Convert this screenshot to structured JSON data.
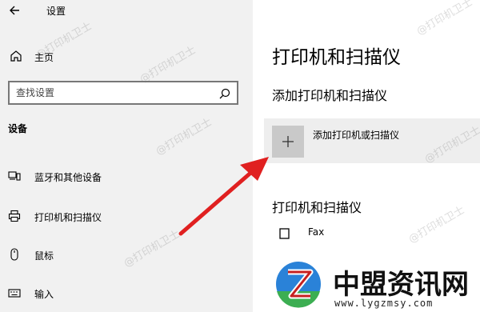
{
  "window": {
    "title": "设置"
  },
  "sidebar": {
    "home_label": "主页",
    "search": {
      "placeholder": "查找设置"
    },
    "section_heading": "设备",
    "items": [
      {
        "label": "蓝牙和其他设备",
        "icon": "devices-icon"
      },
      {
        "label": "打印机和扫描仪",
        "icon": "printer-icon"
      },
      {
        "label": "鼠标",
        "icon": "mouse-icon"
      },
      {
        "label": "输入",
        "icon": "keyboard-icon"
      }
    ]
  },
  "main": {
    "title": "打印机和扫描仪",
    "add_section_title": "添加打印机和扫描仪",
    "add_button_label": "添加打印机或扫描仪",
    "list_title": "打印机和扫描仪",
    "printers": [
      {
        "name": "Fax",
        "icon": "fax-icon"
      }
    ]
  },
  "watermark": {
    "text": "@打印机卫士"
  },
  "logo": {
    "name": "中盟资讯网",
    "url": "www.lygzmsy.com"
  },
  "colors": {
    "arrow": "#e02020",
    "sidebar_bg": "#f1f1f1",
    "add_row_bg": "#eeeeee"
  }
}
